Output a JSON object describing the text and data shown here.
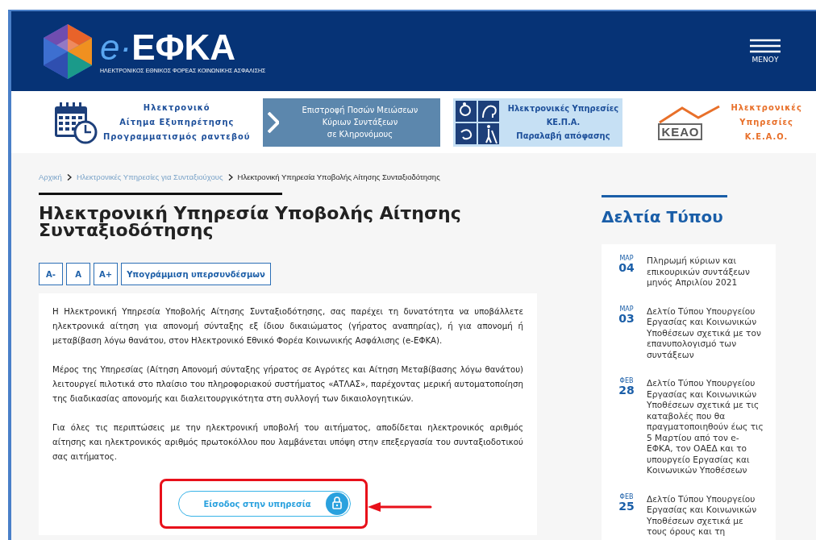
{
  "header": {
    "logo": {
      "prefix": "e·",
      "name": "ΕΦΚΑ",
      "tagline": "ΗΛΕΚΤΡΟΝΙΚΟΣ ΕΘΝΙΚΟΣ ΦΟΡΕΑΣ ΚΟΙΝΩΝΙΚΗΣ ΑΣΦΑΛΙΣΗΣ"
    },
    "menu_label": "ΜΕΝΟΥ"
  },
  "banners": [
    {
      "kind": "calendar",
      "lines": [
        "Ηλεκτρονικό",
        "Αίτημα Εξυπηρέτησης",
        "Προγραμματισμός ραντεβού"
      ]
    },
    {
      "kind": "arrow",
      "lines": [
        "Επιστροφή Ποσών Μειώσεων",
        "Κύριων Συντάξεων",
        "σε Κληρονόμους"
      ]
    },
    {
      "kind": "accessibility",
      "lines": [
        "Ηλεκτρονικές Υπηρεσίες",
        "ΚΕ.Π.Α.",
        "Παραλαβή απόφασης"
      ]
    },
    {
      "kind": "keao",
      "logo_text": "ΚΕΑΟ",
      "lines": [
        "Ηλεκτρονικές",
        "Υπηρεσίες",
        "Κ.Ε.Α.Ο."
      ]
    }
  ],
  "breadcrumb": [
    {
      "label": "Αρχική",
      "kind": "link"
    },
    {
      "label": "Ηλεκτρονικές Υπηρεσίες για Συνταξιούχους",
      "kind": "link"
    },
    {
      "label": "Ηλεκτρονική Υπηρεσία Υποβολής Αίτησης Συνταξιοδότησης",
      "kind": "current"
    }
  ],
  "title": "Ηλεκτρονική Υπηρεσία Υποβολής Αίτησης Συνταξιοδότησης",
  "text_tools": [
    "A-",
    "A",
    "A+",
    "Υπογράμμιση υπερσυνδέσμων"
  ],
  "paragraphs": [
    "Η Ηλεκτρονική Υπηρεσία Υποβολής Αίτησης Συνταξιοδότησης, σας παρέχει τη δυνατότητα να υποβάλλετε ηλεκτρονικά αίτηση για απονομή σύνταξης εξ ίδιου δικαιώματος (γήρατος  αναπηρίας), ή για απονομή ή μεταβίβαση λόγω θανάτου, στον Ηλεκτρονικό Εθνικό Φορέα Κοινωνικής Ασφάλισης (e-ΕΦΚΑ).",
    "Μέρος της Υπηρεσίας (Αίτηση Απονομή σύνταξης γήρατος σε Αγρότες και Αίτηση Μεταβίβασης λόγω θανάτου) λειτουργεί πιλοτικά στο πλαίσιο του πληροφοριακού συστήματος «ΑΤΛΑΣ», παρέχοντας μερική αυτοματοποίηση της διαδικασίας απονομής και διαλειτουργικότητα στη συλλογή των δικαιολογητικών.",
    "Για όλες τις περιπτώσεις με την ηλεκτρονική υποβολή του αιτήματος, αποδίδεται ηλεκτρονικός αριθμός αίτησης και ηλεκτρονικός αριθμός πρωτοκόλλου που λαμβάνεται υπόψη στην επεξεργασία του συνταξιοδοτικού σας αιτήματος."
  ],
  "enter_button": {
    "label": "Είσοδος στην υπηρεσία",
    "highlighted": true
  },
  "press": {
    "title": "Δελτία Τύπου",
    "items": [
      {
        "month": "ΜΑΡ",
        "day": "04",
        "text": "Πληρωμή κύριων και επικουρικών συντάξεων μηνός Απριλίου 2021"
      },
      {
        "month": "ΜΑΡ",
        "day": "03",
        "text": "Δελτίο Τύπου Υπουργείου Εργασίας και Κοινωνικών Υποθέσεων σχετικά με τον επανυπολογισμό των συντάξεων"
      },
      {
        "month": "ΦΕΒ",
        "day": "28",
        "text": "Δελτίο Τύπου Υπουργείου Εργασίας και Κοινωνικών Υποθέσεων σχετικά με τις καταβολές που θα πραγματοποιηθούν έως τις 5 Μαρτίου από τον e-ΕΦΚΑ, τον ΟΑΕΔ και το υπουργείο Εργασίας και Κοινωνικών Υποθέσεων"
      },
      {
        "month": "ΦΕΒ",
        "day": "25",
        "text": "Δελτίο Τύπου Υπουργείου Εργασίας και Κοινωνικών Υποθέσεων σχετικά με τους όρους και τη"
      }
    ]
  }
}
